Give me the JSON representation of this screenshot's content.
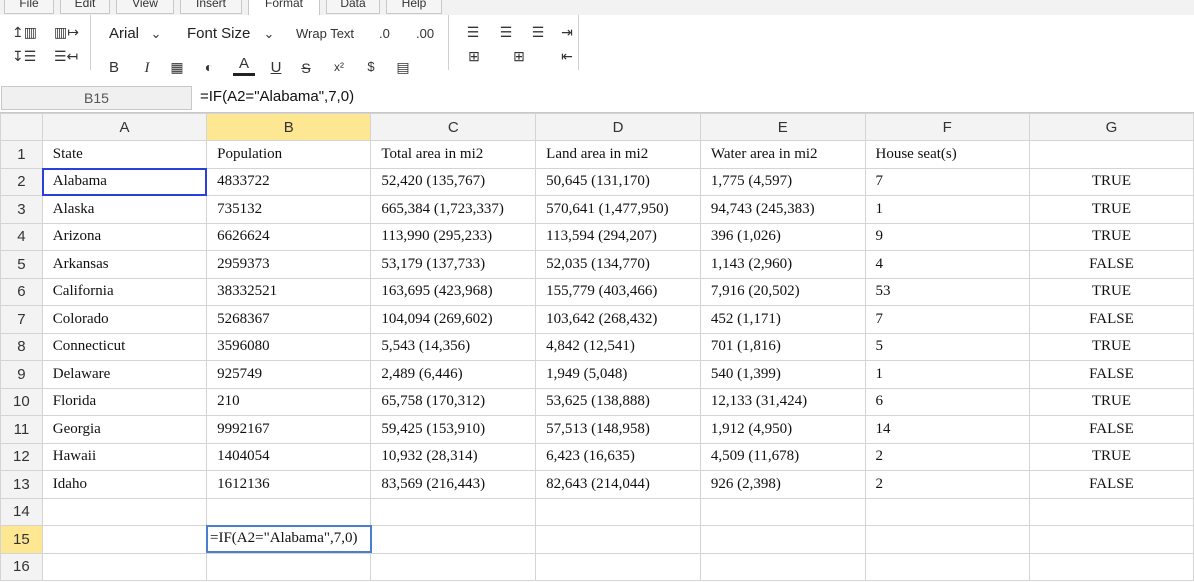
{
  "menu": {
    "tabs": [
      {
        "label": "File"
      },
      {
        "label": "Edit"
      },
      {
        "label": "View"
      },
      {
        "label": "Insert"
      },
      {
        "label": "Format"
      },
      {
        "label": "Data"
      },
      {
        "label": "Help"
      }
    ],
    "active": "Format"
  },
  "toolbar": {
    "font_name": "Arial",
    "font_size_label": "Font Size",
    "wrap_text": "Wrap Text",
    "decimal_decrease": ".0",
    "decimal_increase": ".00",
    "bold": "B",
    "italic": "I",
    "font_color_glyph": "A",
    "underline": "U",
    "strike": "S",
    "superscript": "x²"
  },
  "formula_bar": {
    "cell_ref": "B15",
    "formula": "=IF(A2=\"Alabama\",7,0)"
  },
  "sheet": {
    "columns": [
      "A",
      "B",
      "C",
      "D",
      "E",
      "F",
      "G"
    ],
    "selected_column": "B",
    "selected_row": 15,
    "rows": [
      {
        "n": "1",
        "cells": [
          "State",
          "Population",
          "Total area in mi2",
          "Land area in mi2",
          "Water area in mi2",
          "House seat(s)",
          ""
        ]
      },
      {
        "n": "2",
        "cells": [
          "Alabama",
          "4833722",
          "52,420 (135,767)",
          "50,645 (131,170)",
          "1,775 (4,597)",
          "7",
          "TRUE"
        ]
      },
      {
        "n": "3",
        "cells": [
          "Alaska",
          "735132",
          "665,384 (1,723,337)",
          "570,641 (1,477,950)",
          "94,743 (245,383)",
          "1",
          "TRUE"
        ]
      },
      {
        "n": "4",
        "cells": [
          "Arizona",
          "6626624",
          "113,990 (295,233)",
          "113,594 (294,207)",
          "396 (1,026)",
          "9",
          "TRUE"
        ]
      },
      {
        "n": "5",
        "cells": [
          "Arkansas",
          "2959373",
          "53,179 (137,733)",
          "52,035 (134,770)",
          "1,143 (2,960)",
          "4",
          "FALSE"
        ]
      },
      {
        "n": "6",
        "cells": [
          "California",
          "38332521",
          "163,695 (423,968)",
          "155,779 (403,466)",
          "7,916 (20,502)",
          "53",
          "TRUE"
        ]
      },
      {
        "n": "7",
        "cells": [
          "Colorado",
          "5268367",
          "104,094 (269,602)",
          "103,642 (268,432)",
          "452 (1,171)",
          "7",
          "FALSE"
        ]
      },
      {
        "n": "8",
        "cells": [
          "Connecticut",
          "3596080",
          "5,543 (14,356)",
          "4,842 (12,541)",
          "701 (1,816)",
          "5",
          "TRUE"
        ]
      },
      {
        "n": "9",
        "cells": [
          "Delaware",
          "925749",
          "2,489 (6,446)",
          "1,949 (5,048)",
          "540 (1,399)",
          "1",
          "FALSE"
        ]
      },
      {
        "n": "10",
        "cells": [
          "Florida",
          "210",
          "65,758 (170,312)",
          "53,625 (138,888)",
          "12,133 (31,424)",
          "6",
          "TRUE"
        ]
      },
      {
        "n": "11",
        "cells": [
          "Georgia",
          "9992167",
          "59,425 (153,910)",
          "57,513 (148,958)",
          "1,912 (4,950)",
          "14",
          "FALSE"
        ]
      },
      {
        "n": "12",
        "cells": [
          "Hawaii",
          "1404054",
          "10,932 (28,314)",
          "6,423 (16,635)",
          "4,509 (11,678)",
          "2",
          "TRUE"
        ]
      },
      {
        "n": "13",
        "cells": [
          "Idaho",
          "1612136",
          "83,569 (216,443)",
          "82,643 (214,044)",
          "926 (2,398)",
          "2",
          "FALSE"
        ]
      },
      {
        "n": "14",
        "cells": [
          "",
          "",
          "",
          "",
          "",
          "",
          ""
        ]
      },
      {
        "n": "15",
        "cells": [
          "",
          "",
          "",
          "",
          "",
          "",
          ""
        ]
      },
      {
        "n": "16",
        "cells": [
          "",
          "",
          "",
          "",
          "",
          "",
          ""
        ]
      }
    ],
    "editing_cell_text": "=IF(A2=\"Alabama\",7,0)"
  }
}
